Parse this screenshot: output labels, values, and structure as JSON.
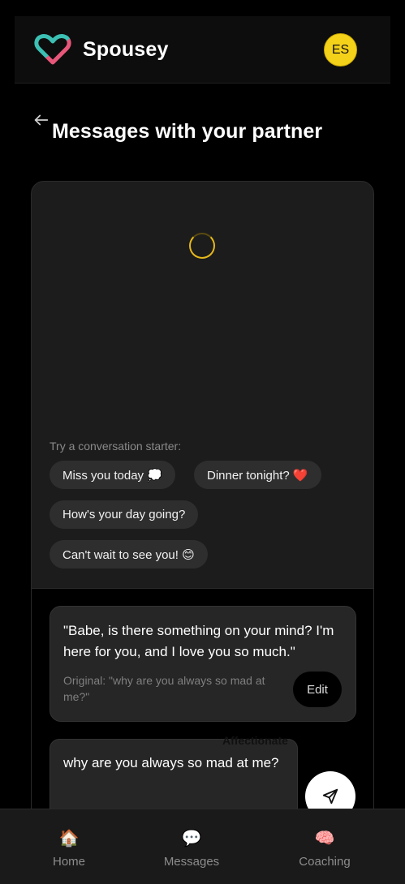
{
  "header": {
    "brand": "Spousey",
    "avatar_initials": "ES",
    "avatar_color": "#f5d21a",
    "logo_icon": "heart-logo-icon"
  },
  "page": {
    "title": "Messages with your partner",
    "back_icon": "arrow-left-icon"
  },
  "chat": {
    "loading_indicator": "spinner",
    "starter_label": "Try a conversation starter:",
    "starters": [
      "Miss you today 💭",
      "Dinner tonight? ❤️",
      "How's your day going?",
      "Can't wait to see you! 😊"
    ]
  },
  "suggestion": {
    "text": "\"Babe, is there something on your mind? I'm here for you, and I love you so much.\"",
    "original": "Original: \"why are you always so mad at me?\"",
    "edit_label": "Edit",
    "tone_label": "Affectionate"
  },
  "composer": {
    "value": "why are you always so mad at me?",
    "send_icon": "send-icon"
  },
  "nav": {
    "items": [
      {
        "emoji": "🏠",
        "label": "Home",
        "icon": "home-icon"
      },
      {
        "emoji": "💬",
        "label": "Messages",
        "icon": "speech-bubble-icon"
      },
      {
        "emoji": "🧠",
        "label": "Coaching",
        "icon": "brain-icon"
      }
    ]
  },
  "colors": {
    "accent_yellow": "#f5d21a",
    "spinner": "#e6b81a",
    "logo_teal": "#3cc0b4",
    "logo_pink": "#e8577a"
  }
}
